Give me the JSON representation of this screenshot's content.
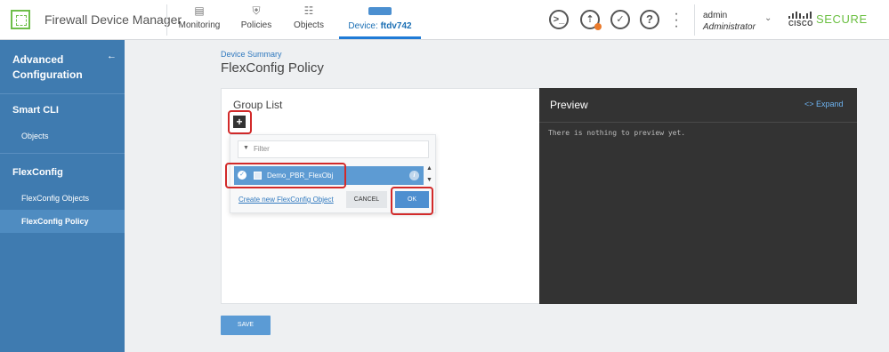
{
  "header": {
    "app_title": "Firewall Device Manager",
    "nav": [
      {
        "label": "Monitoring",
        "icon": "monitoring-icon"
      },
      {
        "label": "Policies",
        "icon": "policies-icon"
      },
      {
        "label": "Objects",
        "icon": "objects-icon"
      }
    ],
    "device": {
      "prefix": "Device:",
      "name": "ftdv742"
    },
    "user": {
      "name": "admin",
      "role": "Administrator"
    },
    "brand": {
      "cisco": "CISCO",
      "secure": "SECURE"
    },
    "icons": [
      "cli-console-icon",
      "deployment-icon",
      "task-list-icon",
      "help-icon",
      "more-options-icon"
    ]
  },
  "sidebar": {
    "title": "Advanced Configuration",
    "sections": [
      {
        "label": "Smart CLI",
        "items": [
          {
            "label": "Objects"
          }
        ]
      },
      {
        "label": "FlexConfig",
        "items": [
          {
            "label": "FlexConfig Objects"
          },
          {
            "label": "FlexConfig Policy",
            "active": true
          }
        ]
      }
    ]
  },
  "main": {
    "breadcrumb": "Device Summary",
    "title": "FlexConfig Policy",
    "group_list": {
      "title": "Group List",
      "add_symbol": "+",
      "filter_placeholder": "Filter",
      "items": [
        {
          "label": "Demo_PBR_FlexObj",
          "selected": true
        }
      ],
      "create_link": "Create new FlexConfig Object",
      "cancel_label": "CANCEL",
      "ok_label": "OK"
    },
    "preview": {
      "title": "Preview",
      "expand_label": "Expand",
      "empty_text": "There is nothing to preview yet."
    },
    "save_label": "SAVE"
  },
  "colors": {
    "sidebar_bg": "#3f7bb0",
    "accent_blue": "#1f7bd6",
    "brand_green": "#6abf40",
    "highlight_red": "#d22a2a",
    "preview_bg": "#333333"
  }
}
